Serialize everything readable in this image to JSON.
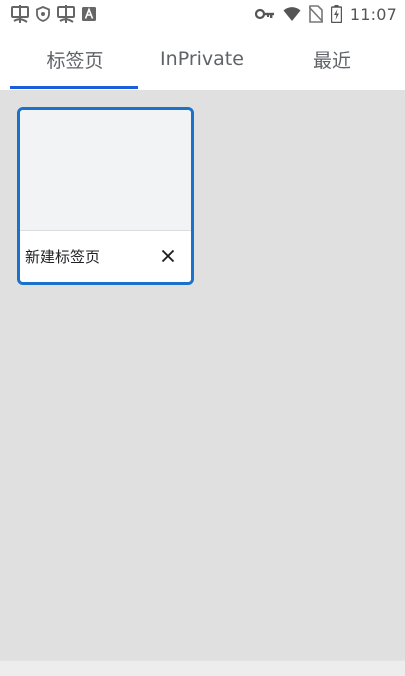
{
  "status_bar": {
    "time": "11:07",
    "left_icons": [
      "app-notification-icon",
      "shield-icon",
      "app-notification-icon",
      "text-icon"
    ],
    "right_icons": [
      "vpn-key-icon",
      "wifi-icon",
      "no-sim-icon",
      "battery-charging-icon"
    ]
  },
  "tabs": [
    {
      "label": "标签页",
      "selected": true
    },
    {
      "label": "InPrivate",
      "selected": false
    },
    {
      "label": "最近",
      "selected": false
    }
  ],
  "open_tabs": [
    {
      "title": "新建标签页"
    }
  ],
  "colors": {
    "accent": "#1d5fd6",
    "card_border": "#1a73c9",
    "background": "#e0e0e0"
  }
}
